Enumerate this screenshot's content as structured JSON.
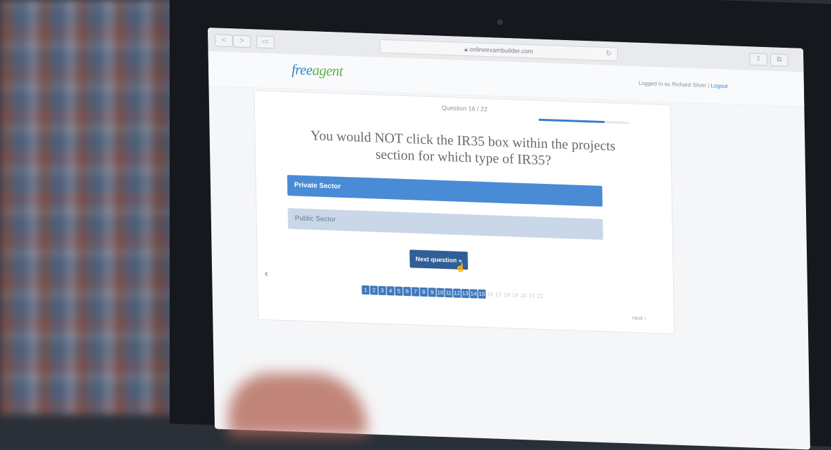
{
  "browser": {
    "url": "onlineexambuilder.com",
    "back_glyph": "<",
    "forward_glyph": ">"
  },
  "header": {
    "logo_part1": "free",
    "logo_part2": "agent",
    "login_text": "Logged in as Richard Silver",
    "logout_label": "Logout",
    "separator": " | "
  },
  "quiz": {
    "question_counter": "Question 16 / 22",
    "progress_fraction": 0.7272,
    "question_text": "You would NOT click the IR35 box within the projects section for which type of IR35?",
    "options": [
      {
        "label": "Private Sector",
        "selected": true
      },
      {
        "label": "Public Sector",
        "selected": false
      }
    ],
    "next_button_label": "Next question »",
    "prev_glyph": "‹",
    "next_nav_label": "next ›",
    "pages_answered": [
      "1",
      "2",
      "3",
      "4",
      "5",
      "6",
      "7",
      "8",
      "9",
      "10",
      "11",
      "12",
      "13",
      "14",
      "15"
    ],
    "pages_remaining": [
      "16",
      "17",
      "18",
      "19",
      "20",
      "21",
      "22"
    ]
  },
  "colors": {
    "accent": "#4a8bd6",
    "button": "#2f5f96",
    "logo_blue": "#2c86c9",
    "logo_green": "#5fb04a"
  }
}
